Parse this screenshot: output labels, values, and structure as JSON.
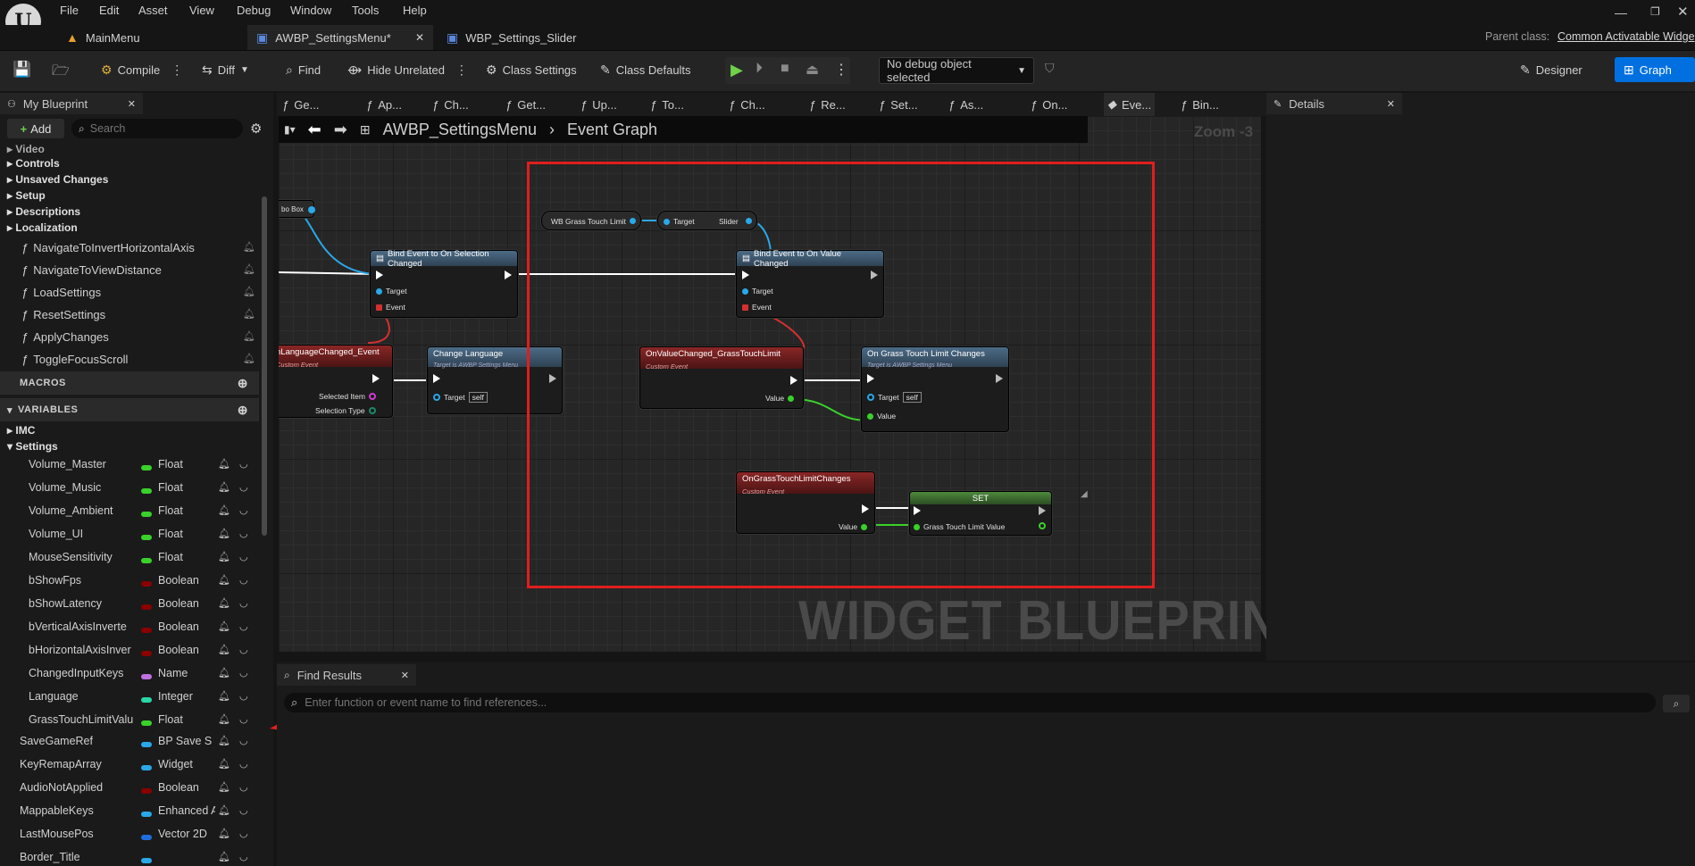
{
  "menu": [
    "File",
    "Edit",
    "Asset",
    "View",
    "Debug",
    "Window",
    "Tools",
    "Help"
  ],
  "tabs": [
    {
      "label": "MainMenu"
    },
    {
      "label": "AWBP_SettingsMenu*"
    },
    {
      "label": "WBP_Settings_Slider"
    }
  ],
  "parent_class": {
    "label": "Parent class:",
    "value": "Common Activatable Widge"
  },
  "toolbar": {
    "compile": "Compile",
    "diff": "Diff",
    "find": "Find",
    "hide_unrelated": "Hide Unrelated",
    "class_settings": "Class Settings",
    "class_defaults": "Class Defaults",
    "debug_object": "No debug object selected",
    "designer": "Designer",
    "graph": "Graph"
  },
  "my_blueprint": {
    "title": "My Blueprint",
    "add": "Add",
    "search_placeholder": "Search",
    "categories": [
      "Video",
      "Controls",
      "Unsaved Changes",
      "Setup",
      "Descriptions",
      "Localization"
    ],
    "functions": [
      "NavigateToInvertHorizontalAxis",
      "NavigateToViewDistance",
      "LoadSettings",
      "ResetSettings",
      "ApplyChanges",
      "ToggleFocusScroll"
    ],
    "macros": "MACROS",
    "variables": "VARIABLES",
    "imc": "IMC",
    "settings": "Settings",
    "vars": [
      {
        "name": "Volume_Master",
        "type": "Float",
        "color": "#39d12a"
      },
      {
        "name": "Volume_Music",
        "type": "Float",
        "color": "#39d12a"
      },
      {
        "name": "Volume_Ambient",
        "type": "Float",
        "color": "#39d12a"
      },
      {
        "name": "Volume_UI",
        "type": "Float",
        "color": "#39d12a"
      },
      {
        "name": "MouseSensitivity",
        "type": "Float",
        "color": "#39d12a"
      },
      {
        "name": "bShowFps",
        "type": "Boolean",
        "color": "#8a0000"
      },
      {
        "name": "bShowLatency",
        "type": "Boolean",
        "color": "#8a0000"
      },
      {
        "name": "bVerticalAxisInverte",
        "type": "Boolean",
        "color": "#8a0000"
      },
      {
        "name": "bHorizontalAxisInver",
        "type": "Boolean",
        "color": "#8a0000"
      },
      {
        "name": "ChangedInputKeys",
        "type": "Name",
        "color": "#c070e0"
      },
      {
        "name": "Language",
        "type": "Integer",
        "color": "#2ad6a8"
      },
      {
        "name": "GrassTouchLimitValu",
        "type": "Float",
        "color": "#39d12a"
      }
    ],
    "outer_vars": [
      {
        "name": "SaveGameRef",
        "type": "BP Save S",
        "color": "#2aa8e8"
      },
      {
        "name": "KeyRemapArray",
        "type": "Widget",
        "color": "#2aa8e8"
      },
      {
        "name": "AudioNotApplied",
        "type": "Boolean",
        "color": "#8a0000"
      },
      {
        "name": "MappableKeys",
        "type": "Enhanced A",
        "color": "#2aa8e8"
      },
      {
        "name": "LastMousePos",
        "type": "Vector 2D",
        "color": "#1e6ee0"
      },
      {
        "name": "Border_Title",
        "type": "",
        "color": "#2aa8e8"
      }
    ]
  },
  "graph_tabs": [
    "Ge...",
    "Ap...",
    "Ch...",
    "Get...",
    "Up...",
    "To...",
    "Ch...",
    "Re...",
    "Set...",
    "As...",
    "On...",
    "Eve...",
    "Bin..."
  ],
  "graph": {
    "breadcrumb_root": "AWBP_SettingsMenu",
    "breadcrumb_leaf": "Event Graph",
    "zoom": "Zoom -3",
    "watermark": "WIDGET BLUEPRINT",
    "nodes": {
      "combo_box": "bo Box",
      "bind_selection": "Bind Event to On Selection Changed",
      "bind_value": "Bind Event to On Value Changed",
      "wb_grass": "WB Grass Touch Limit",
      "target": "Target",
      "slider": "Slider",
      "event": "Event",
      "lang_event": "nLanguageChanged_Event",
      "custom_event": "Custom Event",
      "selected_item": "Selected Item",
      "selection_type": "Selection Type",
      "change_language": "Change Language",
      "target_is": "Target is AWBP Settings Menu",
      "self": "self",
      "on_value_changed": "OnValueChanged_GrassTouchLimit",
      "value": "Value",
      "on_grass_changes": "On Grass Touch Limit Changes",
      "on_grass_event": "OnGrassTouchLimitChanges",
      "set": "SET",
      "grass_value": "Grass Touch Limit Value"
    }
  },
  "details": {
    "title": "Details"
  },
  "find_results": {
    "title": "Find Results",
    "placeholder": "Enter function or event name to find references..."
  }
}
